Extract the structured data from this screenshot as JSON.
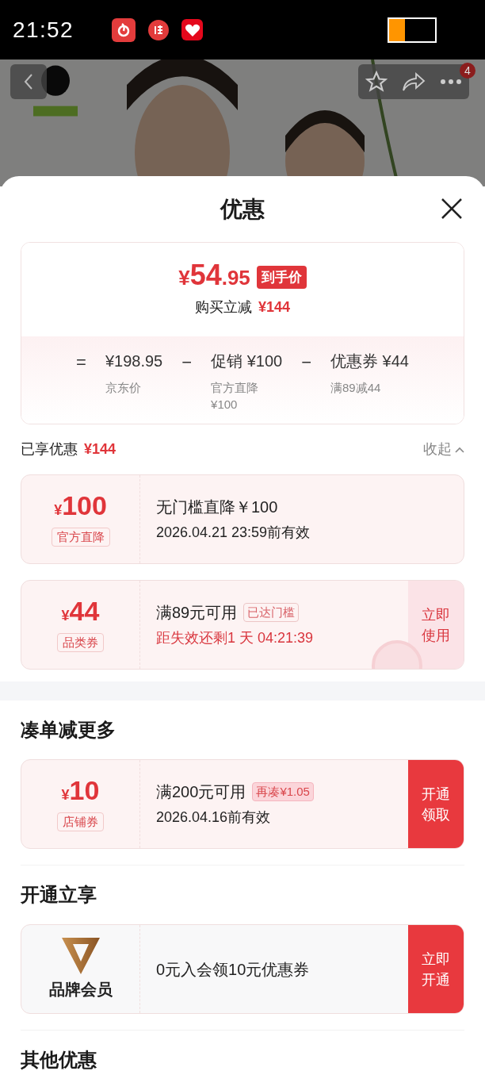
{
  "status_bar": {
    "time": "21:52"
  },
  "header": {
    "notification_count": "4"
  },
  "sheet": {
    "title": "优惠",
    "summary": {
      "price_symbol": "¥",
      "price_int": "54",
      "price_dec": ".95",
      "price_tag": "到手价",
      "saving_label": "购买立减",
      "saving_value": "¥144",
      "formula": [
        {
          "kind": "op",
          "text": "="
        },
        {
          "kind": "term",
          "text": "¥198.95",
          "note": "京东价"
        },
        {
          "kind": "op",
          "text": "−"
        },
        {
          "kind": "term",
          "text": "促销 ¥100",
          "note": "官方直降¥100"
        },
        {
          "kind": "op",
          "text": "−"
        },
        {
          "kind": "term",
          "text": "优惠券 ¥44",
          "note": "满89减44"
        }
      ]
    },
    "enjoyed": {
      "label": "已享优惠",
      "value": "¥144",
      "toggle": "收起",
      "expanded": true
    },
    "coupons": [
      {
        "kind": "coupon",
        "symbol": "¥",
        "amount": "100",
        "type": "官方直降",
        "title": "无门槛直降￥100",
        "detail": "2026.04.21 23:59前有效",
        "detail_alert": false
      },
      {
        "kind": "coupon",
        "symbol": "¥",
        "amount": "44",
        "type": "品类券",
        "title": "满89元可用",
        "badge": "已达门槛",
        "detail": "距失效还剩1 天 04:21:39",
        "detail_alert": true,
        "claimed": true,
        "action": "立即使用"
      }
    ],
    "sections": [
      {
        "title": "凑单减更多",
        "cards": [
          {
            "kind": "coupon",
            "symbol": "¥",
            "amount": "10",
            "type": "店铺券",
            "title": "满200元可用",
            "badge": "再凑¥1.05",
            "detail": "2026.04.16前有效",
            "detail_alert": false,
            "claimed": false,
            "action": "开通领取"
          }
        ]
      },
      {
        "title": "开通立享",
        "cards": [
          {
            "kind": "membership",
            "type": "品牌会员",
            "title": "0元入会领10元优惠券",
            "claimed": false,
            "action": "立即开通"
          }
        ]
      },
      {
        "title": "其他优惠"
      }
    ]
  }
}
